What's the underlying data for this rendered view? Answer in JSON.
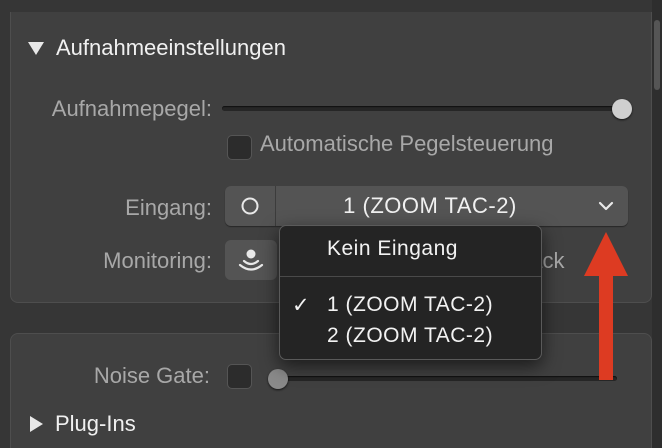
{
  "recording_section": {
    "title": "Aufnahmeeinstellungen",
    "level_label": "Aufnahmepegel:",
    "level_value": 1.0,
    "auto_level_label": "Automatische Pegelsteuerung",
    "auto_level_checked": false,
    "input_label": "Eingang:",
    "input_value": "1  (ZOOM TAC-2)",
    "monitoring_label": "Monitoring:",
    "monitoring_partial_text": "back"
  },
  "input_menu": {
    "items": [
      {
        "label": "Kein Eingang",
        "checked": false
      },
      {
        "label": "1  (ZOOM TAC-2)",
        "checked": true
      },
      {
        "label": "2  (ZOOM TAC-2)",
        "checked": false
      }
    ]
  },
  "lower_section": {
    "noise_gate_label": "Noise Gate:",
    "noise_gate_checked": false,
    "noise_gate_level": 0.0,
    "plugins_title": "Plug-Ins"
  },
  "colors": {
    "annotation_arrow": "#dd3b22",
    "menu_background": "#242424",
    "panel_background": "#404040"
  }
}
